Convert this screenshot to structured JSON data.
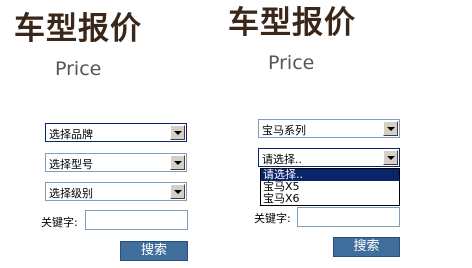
{
  "left": {
    "title_cn": "车型报价",
    "title_en": "Price",
    "select_brand": "选择品牌",
    "select_model": "选择型号",
    "select_level": "选择级别",
    "keyword_label": "关键字:",
    "keyword_value": "",
    "search_label": "搜索"
  },
  "right": {
    "title_cn": "车型报价",
    "title_en": "Price",
    "select_series": "宝马系列",
    "select_model": "请选择..",
    "dropdown_options": [
      "请选择..",
      "宝马X5",
      "宝马X6"
    ],
    "keyword_label": "关键字:",
    "keyword_value": "",
    "search_label": "搜索"
  },
  "colors": {
    "title": "#3b2719",
    "button_bg": "#3f6e9c",
    "selection_bg": "#0a246a",
    "input_border": "#7f9db9"
  }
}
